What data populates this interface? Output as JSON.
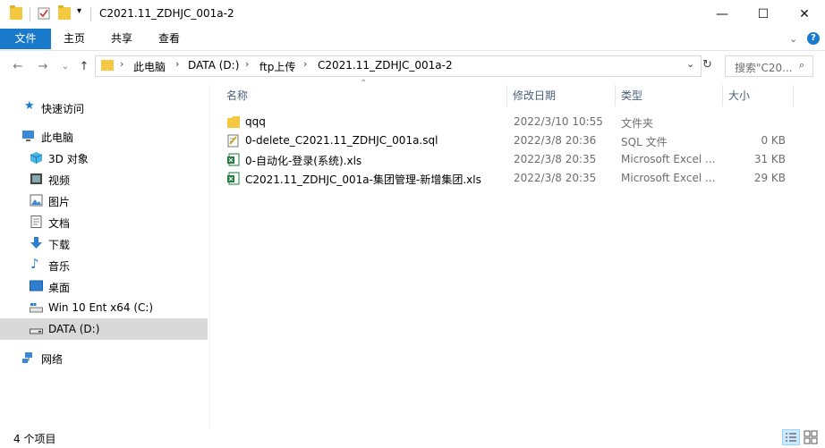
{
  "window": {
    "title": "C2021.11_ZDHJC_001a-2",
    "minimize": "—",
    "maximize": "☐",
    "close": "✕"
  },
  "ribbon": {
    "tabs": [
      "文件",
      "主页",
      "共享",
      "查看"
    ]
  },
  "address": {
    "crumbs": [
      "此电脑",
      "DATA (D:)",
      "ftp上传",
      "C2021.11_ZDHJC_001a-2"
    ]
  },
  "search": {
    "placeholder": "搜索\"C20..."
  },
  "nav": {
    "items": [
      {
        "label": "快速访问",
        "icon": "star-icon"
      },
      {
        "label": "此电脑",
        "icon": "computer-icon"
      },
      {
        "label": "3D 对象",
        "icon": "cube-icon"
      },
      {
        "label": "视频",
        "icon": "video-icon"
      },
      {
        "label": "图片",
        "icon": "picture-icon"
      },
      {
        "label": "文档",
        "icon": "document-icon"
      },
      {
        "label": "下载",
        "icon": "download-icon"
      },
      {
        "label": "音乐",
        "icon": "music-icon"
      },
      {
        "label": "桌面",
        "icon": "desktop-icon"
      },
      {
        "label": "Win 10 Ent x64 (C:)",
        "icon": "drive-c-icon"
      },
      {
        "label": "DATA (D:)",
        "icon": "drive-d-icon"
      },
      {
        "label": "网络",
        "icon": "network-icon"
      }
    ]
  },
  "columns": {
    "name": "名称",
    "date": "修改日期",
    "type": "类型",
    "size": "大小"
  },
  "files": [
    {
      "name": "qqq",
      "date": "2022/3/10 10:55",
      "type": "文件夹",
      "size": "",
      "icon": "folder-icon"
    },
    {
      "name": "0-delete_C2021.11_ZDHJC_001a.sql",
      "date": "2022/3/8 20:36",
      "type": "SQL 文件",
      "size": "0 KB",
      "icon": "sql-file-icon"
    },
    {
      "name": "0-自动化-登录(系统).xls",
      "date": "2022/3/8 20:35",
      "type": "Microsoft Excel ...",
      "size": "31 KB",
      "icon": "excel-file-icon"
    },
    {
      "name": "C2021.11_ZDHJC_001a-集团管理-新增集团.xls",
      "date": "2022/3/8 20:35",
      "type": "Microsoft Excel ...",
      "size": "29 KB",
      "icon": "excel-file-icon"
    }
  ],
  "status": {
    "count": "4 个项目"
  },
  "colors": {
    "accent": "#1979ca",
    "folder": "#f5c842",
    "selection": "#d9d9d9",
    "header_text": "#4c607a"
  }
}
